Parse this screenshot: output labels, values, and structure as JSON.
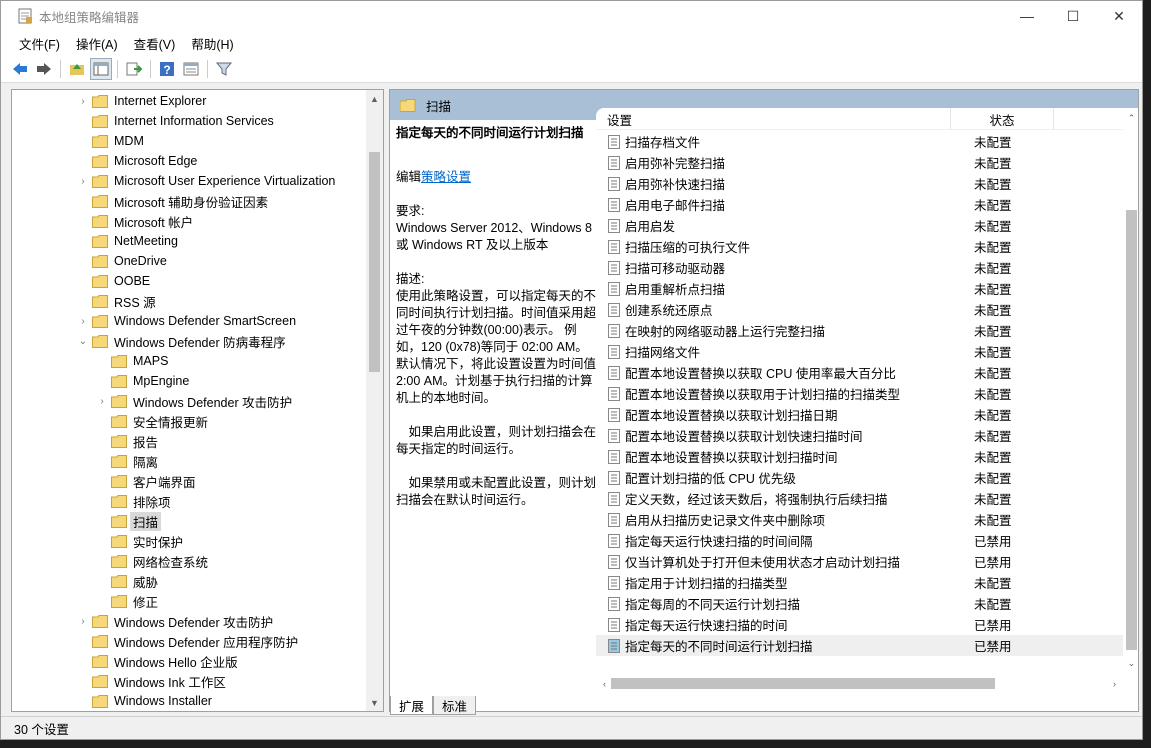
{
  "window": {
    "title": "本地组策略编辑器",
    "controls": [
      "—",
      "☐",
      "✕"
    ]
  },
  "menu": [
    "文件(F)",
    "操作(A)",
    "查看(V)",
    "帮助(H)"
  ],
  "tree": [
    {
      "label": "Internet Explorer",
      "indent": 1,
      "expander": "›"
    },
    {
      "label": "Internet Information Services",
      "indent": 1,
      "expander": ""
    },
    {
      "label": "MDM",
      "indent": 1,
      "expander": ""
    },
    {
      "label": "Microsoft Edge",
      "indent": 1,
      "expander": ""
    },
    {
      "label": "Microsoft User Experience Virtualization",
      "indent": 1,
      "expander": "›"
    },
    {
      "label": "Microsoft 辅助身份验证因素",
      "indent": 1,
      "expander": ""
    },
    {
      "label": "Microsoft 帐户",
      "indent": 1,
      "expander": ""
    },
    {
      "label": "NetMeeting",
      "indent": 1,
      "expander": ""
    },
    {
      "label": "OneDrive",
      "indent": 1,
      "expander": ""
    },
    {
      "label": "OOBE",
      "indent": 1,
      "expander": ""
    },
    {
      "label": "RSS 源",
      "indent": 1,
      "expander": ""
    },
    {
      "label": "Windows Defender SmartScreen",
      "indent": 1,
      "expander": "›"
    },
    {
      "label": "Windows Defender 防病毒程序",
      "indent": 1,
      "expander": "⌄"
    },
    {
      "label": "MAPS",
      "indent": 2,
      "expander": ""
    },
    {
      "label": "MpEngine",
      "indent": 2,
      "expander": ""
    },
    {
      "label": "Windows Defender 攻击防护",
      "indent": 2,
      "expander": "›"
    },
    {
      "label": "安全情报更新",
      "indent": 2,
      "expander": ""
    },
    {
      "label": "报告",
      "indent": 2,
      "expander": ""
    },
    {
      "label": "隔离",
      "indent": 2,
      "expander": ""
    },
    {
      "label": "客户端界面",
      "indent": 2,
      "expander": ""
    },
    {
      "label": "排除项",
      "indent": 2,
      "expander": ""
    },
    {
      "label": "扫描",
      "indent": 2,
      "expander": "",
      "selected": true
    },
    {
      "label": "实时保护",
      "indent": 2,
      "expander": ""
    },
    {
      "label": "网络检查系统",
      "indent": 2,
      "expander": ""
    },
    {
      "label": "威胁",
      "indent": 2,
      "expander": ""
    },
    {
      "label": "修正",
      "indent": 2,
      "expander": ""
    },
    {
      "label": "Windows Defender 攻击防护",
      "indent": 1,
      "expander": "›"
    },
    {
      "label": "Windows Defender 应用程序防护",
      "indent": 1,
      "expander": ""
    },
    {
      "label": "Windows Hello 企业版",
      "indent": 1,
      "expander": ""
    },
    {
      "label": "Windows Ink 工作区",
      "indent": 1,
      "expander": ""
    },
    {
      "label": "Windows Installer",
      "indent": 1,
      "expander": ""
    }
  ],
  "right_header": "扫描",
  "description": {
    "title": "指定每天的不同时间运行计划扫描",
    "edit_prefix": "编辑",
    "edit_link": "策略设置",
    "req_label": "要求:",
    "req_text": "Windows Server 2012、Windows 8 或 Windows RT 及以上版本",
    "desc_label": "描述:",
    "desc_text": "使用此策略设置，可以指定每天的不同时间执行计划扫描。时间值采用超过午夜的分钟数(00:00)表示。 例如，120 (0x78)等同于 02:00 AM。默认情况下，将此设置设置为时间值 2:00 AM。计划基于执行扫描的计算机上的本地时间。",
    "enabled_text": "　如果启用此设置，则计划扫描会在每天指定的时间运行。",
    "disabled_text": "　如果禁用或未配置此设置，则计划扫描会在默认时间运行。"
  },
  "list": {
    "col_setting": "设置",
    "col_state": "状态",
    "rows": [
      {
        "name": "扫描存档文件",
        "state": "未配置"
      },
      {
        "name": "启用弥补完整扫描",
        "state": "未配置"
      },
      {
        "name": "启用弥补快速扫描",
        "state": "未配置"
      },
      {
        "name": "启用电子邮件扫描",
        "state": "未配置"
      },
      {
        "name": "启用启发",
        "state": "未配置"
      },
      {
        "name": "扫描压缩的可执行文件",
        "state": "未配置"
      },
      {
        "name": "扫描可移动驱动器",
        "state": "未配置"
      },
      {
        "name": "启用重解析点扫描",
        "state": "未配置"
      },
      {
        "name": "创建系统还原点",
        "state": "未配置"
      },
      {
        "name": "在映射的网络驱动器上运行完整扫描",
        "state": "未配置"
      },
      {
        "name": "扫描网络文件",
        "state": "未配置"
      },
      {
        "name": "配置本地设置替换以获取 CPU 使用率最大百分比",
        "state": "未配置"
      },
      {
        "name": "配置本地设置替换以获取用于计划扫描的扫描类型",
        "state": "未配置"
      },
      {
        "name": "配置本地设置替换以获取计划扫描日期",
        "state": "未配置"
      },
      {
        "name": "配置本地设置替换以获取计划快速扫描时间",
        "state": "未配置"
      },
      {
        "name": "配置本地设置替换以获取计划扫描时间",
        "state": "未配置"
      },
      {
        "name": "配置计划扫描的低 CPU 优先级",
        "state": "未配置"
      },
      {
        "name": "定义天数，经过该天数后，将强制执行后续扫描",
        "state": "未配置"
      },
      {
        "name": "启用从扫描历史记录文件夹中删除项",
        "state": "未配置"
      },
      {
        "name": "指定每天运行快速扫描的时间间隔",
        "state": "已禁用"
      },
      {
        "name": "仅当计算机处于打开但未使用状态才启动计划扫描",
        "state": "已禁用"
      },
      {
        "name": "指定用于计划扫描的扫描类型",
        "state": "未配置"
      },
      {
        "name": "指定每周的不同天运行计划扫描",
        "state": "未配置"
      },
      {
        "name": "指定每天运行快速扫描的时间",
        "state": "已禁用"
      },
      {
        "name": "指定每天的不同时间运行计划扫描",
        "state": "已禁用",
        "selected": true
      }
    ]
  },
  "tabs": [
    "扩展",
    "标准"
  ],
  "status": "30 个设置",
  "colors": {
    "header_bar": "#a9bfd6",
    "folder": "#f6d77a",
    "link": "#0066cc"
  }
}
